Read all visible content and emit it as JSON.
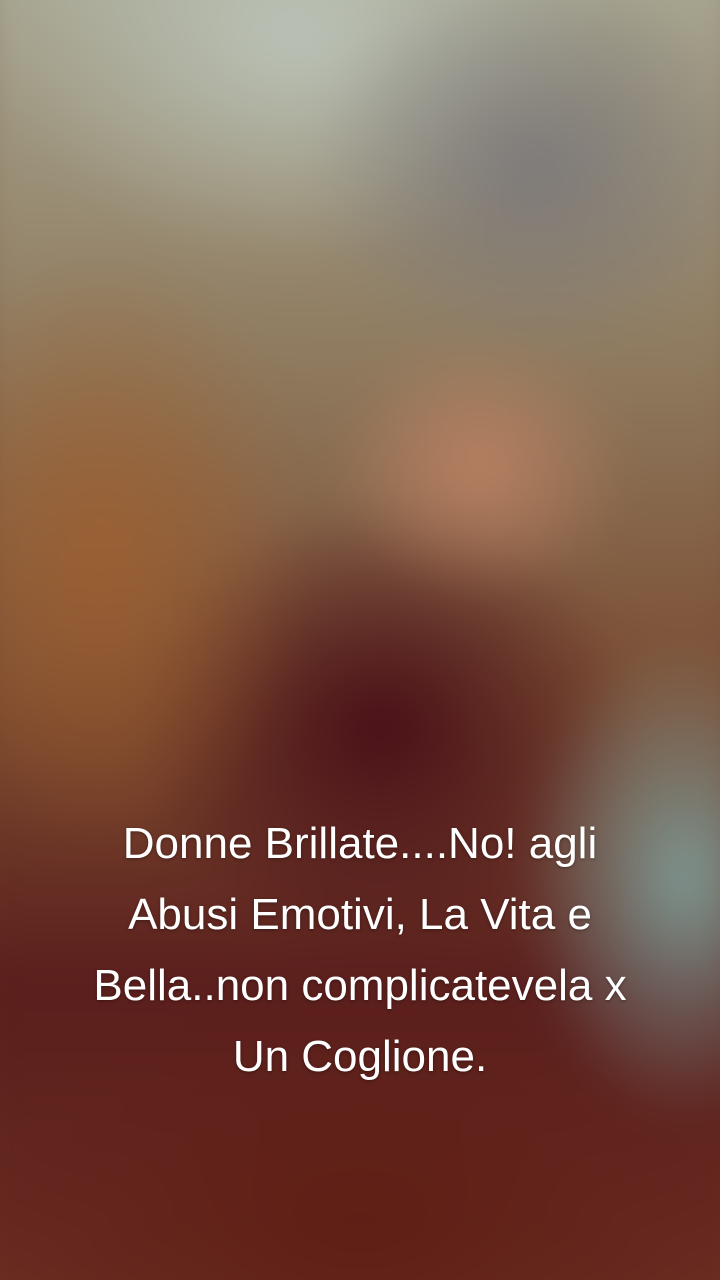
{
  "caption": {
    "lines": [
      "Donne Brillate....No! agli",
      "Abusi Emotivi, La Vita e",
      "Bella..non complicatevela x",
      "Un Coglione."
    ]
  },
  "colors": {
    "caption_text": "#ffffff",
    "background_top": "#a9a995",
    "background_middle": "#7a4a30",
    "background_bottom": "#5a1e1c"
  }
}
